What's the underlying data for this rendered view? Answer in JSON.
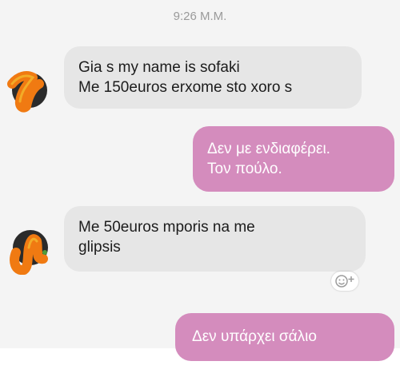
{
  "conversation": {
    "timestamp": "9:26 Μ.Μ.",
    "messages": [
      {
        "direction": "incoming",
        "lines": [
          "Gia s my name is sofaki",
          "Me 150euros erxome sto xoro s"
        ]
      },
      {
        "direction": "outgoing",
        "lines": [
          "Δεν με ενδιαφέρει.",
          "Τον πούλο."
        ]
      },
      {
        "direction": "incoming",
        "lines": [
          "Me 50euros mporis na me",
          "glipsis"
        ]
      },
      {
        "direction": "outgoing",
        "lines": [
          "Δεν υπάρχει σάλιο"
        ]
      }
    ]
  },
  "icons": {
    "avatar": "avatar-doodle-icon",
    "reaction": "add-reaction-emoji-icon"
  },
  "colors": {
    "incoming_bubble": "#e6e6e6",
    "outgoing_bubble": "#d48cbd",
    "avatar_scribble": "#f07a12",
    "background": "#f4f4f4"
  }
}
